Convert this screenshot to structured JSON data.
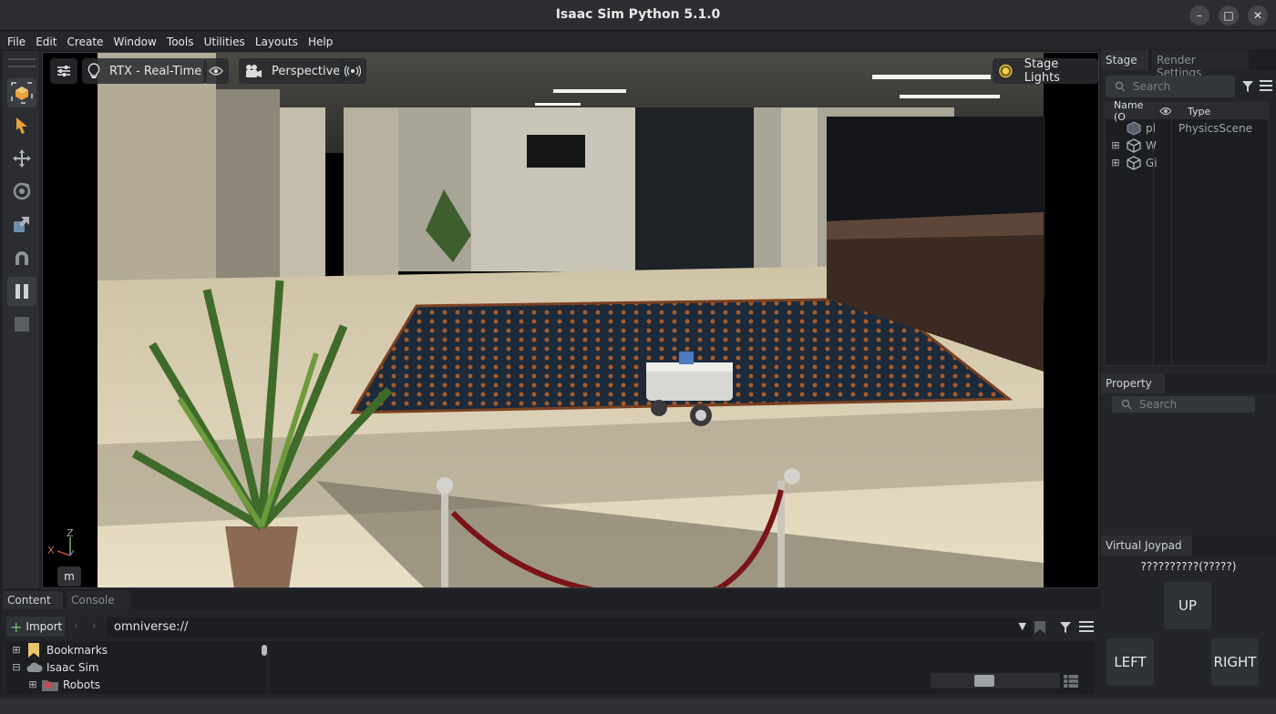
{
  "window": {
    "title": "Isaac Sim Python 5.1.0"
  },
  "menu": [
    "File",
    "Edit",
    "Create",
    "Window",
    "Tools",
    "Utilities",
    "Layouts",
    "Help"
  ],
  "viewport": {
    "renderer_label": "RTX - Real-Time",
    "camera_label": "Perspective",
    "lights_label": "Stage Lights",
    "axis_z": "Z",
    "axis_x": "X",
    "units_label": "m"
  },
  "stage": {
    "tabs": [
      "Stage",
      "Render Settings"
    ],
    "search_placeholder": "Search",
    "columns": {
      "name": "Name (O",
      "type": "Type"
    },
    "rows": [
      {
        "name": "pl",
        "type": "PhysicsScene",
        "expandable": false
      },
      {
        "name": "W",
        "type": "",
        "expandable": true
      },
      {
        "name": "Gi",
        "type": "",
        "expandable": true
      }
    ]
  },
  "property": {
    "title": "Property",
    "search_placeholder": "Search"
  },
  "joypad": {
    "title": "Virtual Joypad",
    "status": "??????????(?????)",
    "up": "UP",
    "left": "LEFT",
    "right": "RIGHT"
  },
  "content": {
    "tabs": [
      "Content",
      "Console"
    ],
    "import_label": "Import",
    "path": "omniverse://",
    "tree": [
      {
        "label": "Bookmarks",
        "expand": "+",
        "indent": 0
      },
      {
        "label": "Isaac Sim",
        "expand": "−",
        "indent": 0
      },
      {
        "label": "Robots",
        "expand": "+",
        "indent": 1
      }
    ]
  },
  "colors": {
    "accent": "#e8a23a",
    "panel": "#232528",
    "viewport_floor": "#e8dcc0"
  }
}
